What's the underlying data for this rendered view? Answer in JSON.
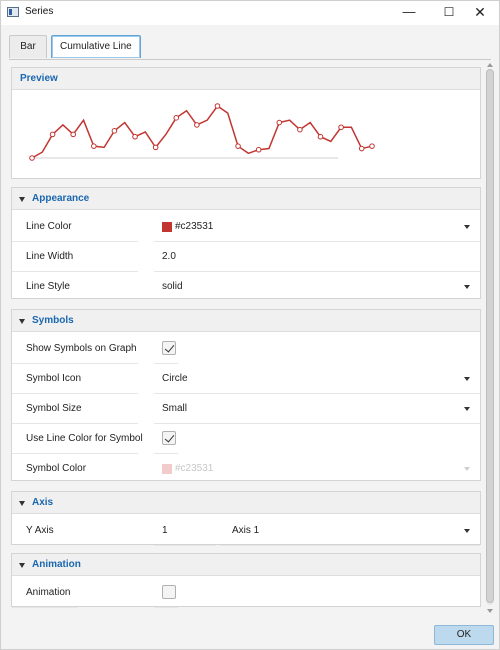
{
  "window": {
    "title": "Series",
    "controls": {
      "minimize": "—",
      "maximize": "☐",
      "close": "✕"
    }
  },
  "tabs": [
    {
      "label": "Bar",
      "active": false
    },
    {
      "label": "Cumulative Line",
      "active": true
    }
  ],
  "preview": {
    "title": "Preview",
    "chart_data": {
      "type": "line",
      "values": [
        0,
        5,
        20,
        28,
        20,
        32,
        10,
        9,
        23,
        30,
        18,
        22,
        9,
        20,
        34,
        40,
        28,
        32,
        44,
        38,
        10,
        4,
        7,
        8,
        30,
        32,
        24,
        30,
        18,
        14,
        26,
        26,
        8,
        10
      ],
      "line_color": "#c23531",
      "show_symbols": true,
      "symbol": "circle"
    }
  },
  "appearance": {
    "title": "Appearance",
    "line_color_label": "Line Color",
    "line_color_value": "#c23531",
    "line_color_hex": "#c23531",
    "line_width_label": "Line Width",
    "line_width_value": "2.0",
    "line_style_label": "Line Style",
    "line_style_value": "solid"
  },
  "symbols": {
    "title": "Symbols",
    "show_label": "Show Symbols on Graph",
    "show_checked": true,
    "icon_label": "Symbol Icon",
    "icon_value": "Circle",
    "size_label": "Symbol Size",
    "size_value": "Small",
    "use_line_color_label": "Use Line Color for Symbol",
    "use_line_color_checked": true,
    "color_label": "Symbol Color",
    "color_value": "#c23531"
  },
  "axis": {
    "title": "Axis",
    "y_axis_label": "Y Axis",
    "y_axis_index": "1",
    "y_axis_value": "Axis 1"
  },
  "animation": {
    "title": "Animation",
    "label": "Animation",
    "checked": false
  },
  "footer": {
    "ok_label": "OK"
  }
}
